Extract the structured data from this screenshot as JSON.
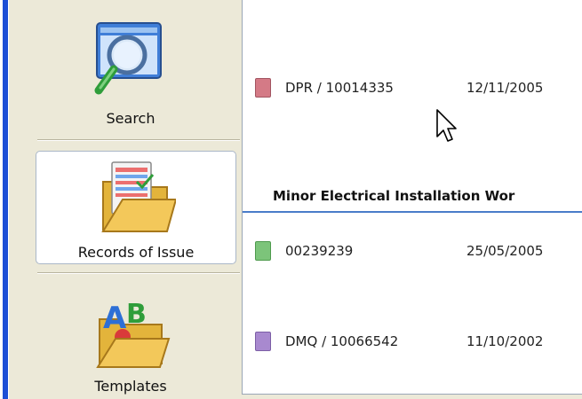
{
  "sidebar": {
    "items": [
      {
        "label": "Search",
        "icon": "magnifier-icon"
      },
      {
        "label": "Records of Issue",
        "icon": "folder-records-icon",
        "selected": true
      },
      {
        "label": "Templates",
        "icon": "folder-templates-icon"
      }
    ]
  },
  "content": {
    "rows_top": [
      {
        "ref": "DPR / 10014335",
        "date": "12/11/2005",
        "icon_color": "#d47a86"
      }
    ],
    "section_title": "Minor Electrical Installation Wor",
    "rows_section": [
      {
        "ref": "00239239",
        "date": "25/05/2005",
        "icon_color": "#7cc47a"
      },
      {
        "ref": "DMQ / 10066542",
        "date": "11/10/2002",
        "icon_color": "#a889cf"
      }
    ]
  },
  "colors": {
    "accent_blue": "#1c4fd6",
    "section_underline": "#4a7cc9"
  }
}
